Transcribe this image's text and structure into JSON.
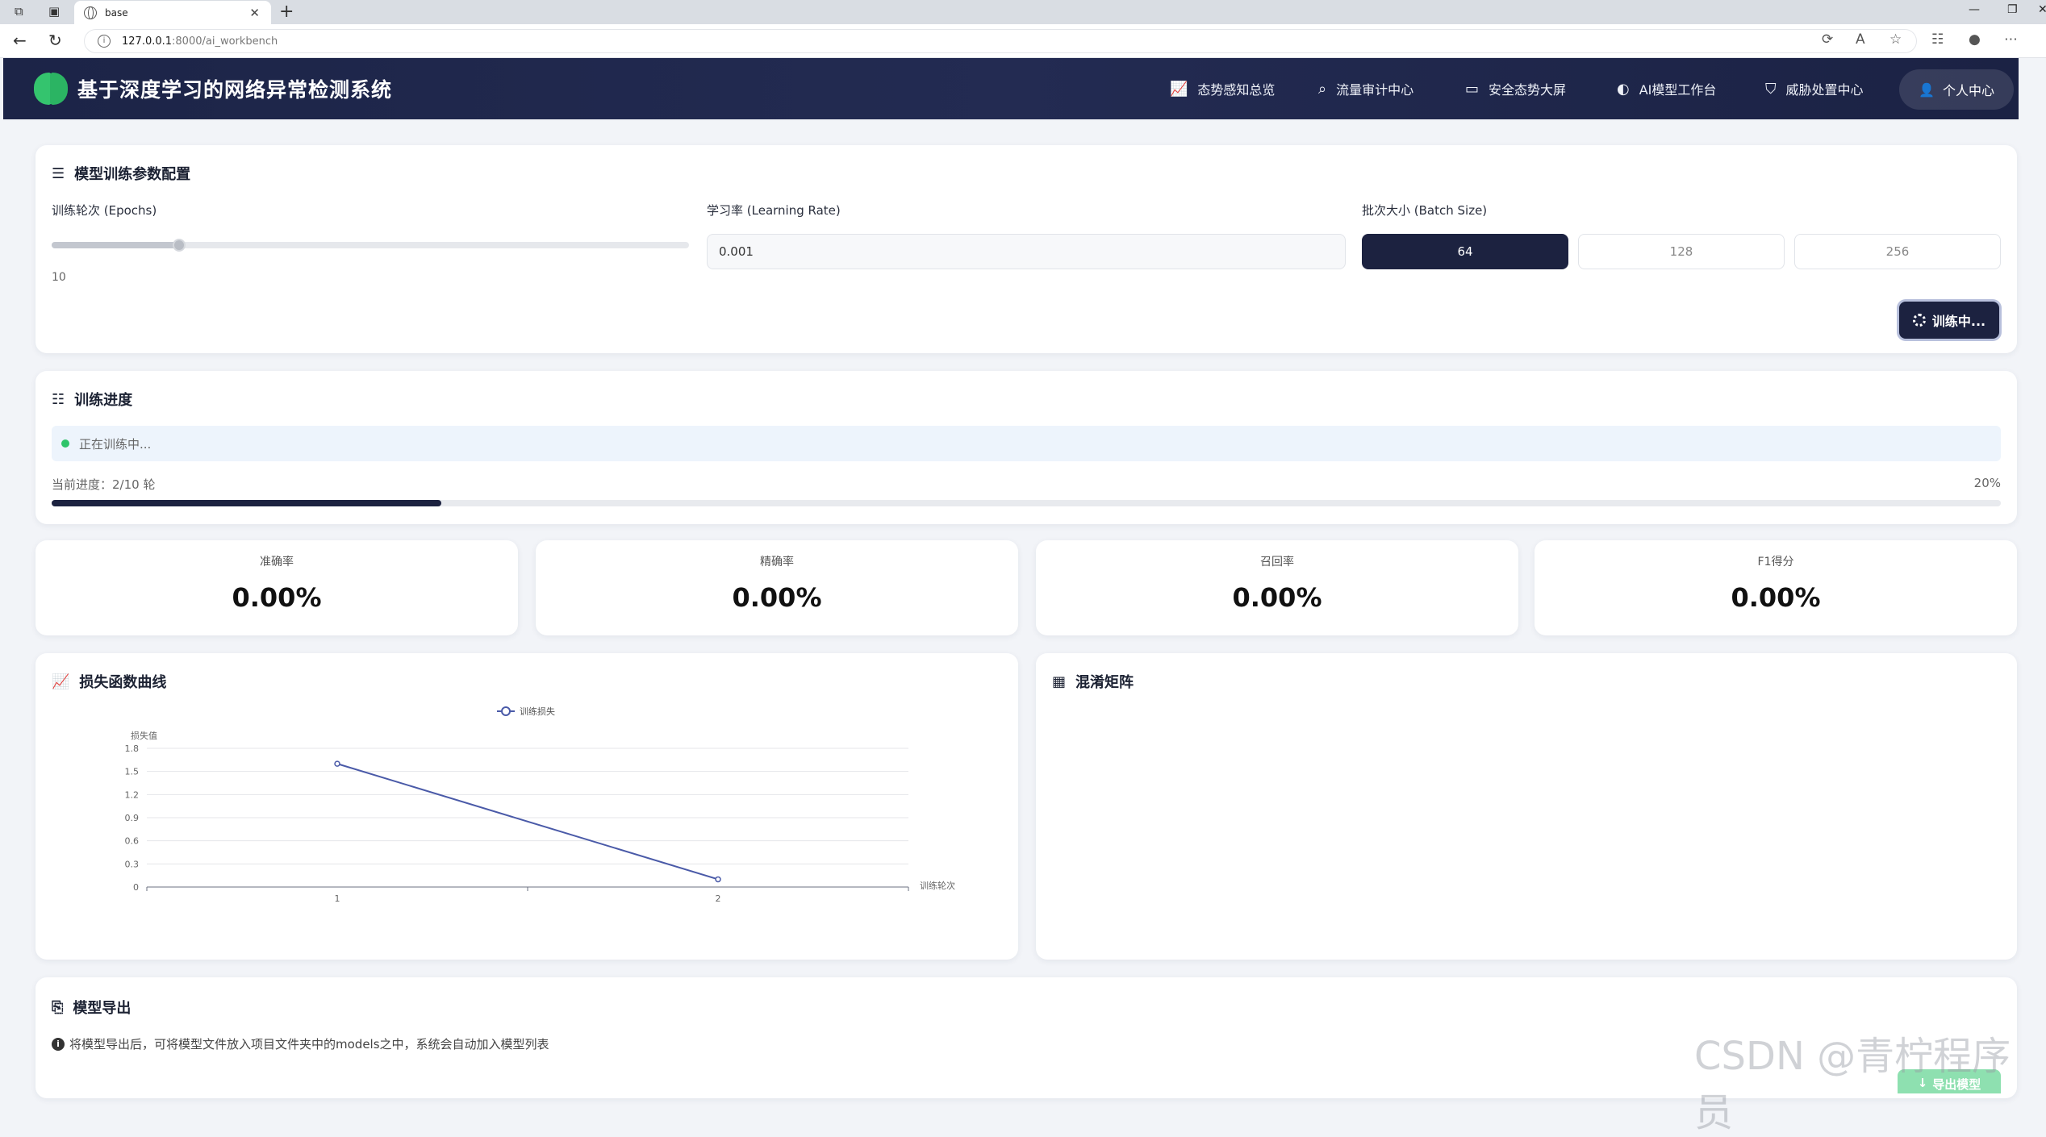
{
  "browser": {
    "tab_title": "base",
    "url_host": "127.0.0.1",
    "url_path": ":8000/ai_workbench"
  },
  "header": {
    "title": "基于深度学习的网络异常检测系统",
    "menu": [
      {
        "label": "态势感知总览",
        "icon": "chart-line-icon"
      },
      {
        "label": "流量审计中心",
        "icon": "search-icon"
      },
      {
        "label": "安全态势大屏",
        "icon": "monitor-icon"
      },
      {
        "label": "AI模型工作台",
        "icon": "brain-icon"
      },
      {
        "label": "威胁处置中心",
        "icon": "shield-icon"
      }
    ],
    "user_label": "个人中心"
  },
  "config": {
    "title": "模型训练参数配置",
    "epochs_label": "训练轮次 (Epochs)",
    "epochs_value": "10",
    "epochs_fraction": 0.2,
    "lr_label": "学习率 (Learning Rate)",
    "lr_value": "0.001",
    "batch_label": "批次大小 (Batch Size)",
    "batch_options": [
      "64",
      "128",
      "256"
    ],
    "batch_selected": "64",
    "train_button": "训练中..."
  },
  "progress": {
    "title": "训练进度",
    "status": "正在训练中...",
    "current_text": "当前进度：2/10 轮",
    "percent_text": "20%",
    "fraction": 0.2
  },
  "metrics": [
    {
      "label": "准确率",
      "value": "0.00%"
    },
    {
      "label": "精确率",
      "value": "0.00%"
    },
    {
      "label": "召回率",
      "value": "0.00%"
    },
    {
      "label": "F1得分",
      "value": "0.00%"
    }
  ],
  "loss_chart": {
    "title": "损失函数曲线"
  },
  "confusion": {
    "title": "混淆矩阵"
  },
  "export": {
    "title": "模型导出",
    "note": "将模型导出后，可将模型文件放入项目文件夹中的models之中，系统会自动加入模型列表",
    "button": "导出模型"
  },
  "watermark": "CSDN @青柠程序员",
  "colors": {
    "primary": "#1c2240",
    "success": "#2fc46a",
    "line": "#4a5aa8"
  },
  "chart_data": {
    "type": "line",
    "x": [
      1,
      2
    ],
    "series": [
      {
        "name": "训练损失",
        "values": [
          1.6,
          0.1
        ]
      }
    ],
    "xlabel": "训练轮次",
    "ylabel": "损失值",
    "ylim": [
      0,
      1.8
    ],
    "yticks": [
      "0",
      "0.3",
      "0.6",
      "0.9",
      "1.2",
      "1.5",
      "1.8"
    ],
    "xticks": [
      "1",
      "2"
    ],
    "legend": "top-center",
    "grid": true
  }
}
